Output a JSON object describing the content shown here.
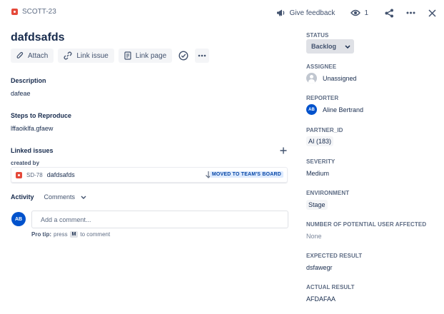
{
  "header": {
    "issue_key": "SCOTT-23",
    "feedback_label": "Give feedback",
    "watch_count": "1"
  },
  "issue": {
    "title": "dafdsafds"
  },
  "toolbar": {
    "attach_label": "Attach",
    "link_issue_label": "Link issue",
    "link_page_label": "Link page"
  },
  "description": {
    "heading": "Description",
    "text": "dafeae"
  },
  "steps": {
    "heading": "Steps to Reproduce",
    "text": "lffaoiklfa.gfaew"
  },
  "linked_issues": {
    "heading": "Linked issues",
    "created_by_label": "created by",
    "items": [
      {
        "key": "SD-78",
        "summary": "dafdsafds",
        "status": "MOVED TO TEAM'S BOARD"
      }
    ]
  },
  "activity": {
    "heading": "Activity",
    "filter_value": "Comments",
    "avatar_initials": "AB",
    "comment_placeholder": "Add a comment...",
    "protip_label": "Pro tip:",
    "protip_press": "press",
    "protip_key": "M",
    "protip_suffix": "to comment"
  },
  "sidebar": {
    "status_label": "STATUS",
    "status_value": "Backlog",
    "assignee_label": "ASSIGNEE",
    "assignee_value": "Unassigned",
    "reporter_label": "REPORTER",
    "reporter_initials": "AB",
    "reporter_name": "Aline Bertrand",
    "partner_id_label": "PARTNER_ID",
    "partner_id_value": "AI (183)",
    "severity_label": "SEVERITY",
    "severity_value": "Medium",
    "environment_label": "ENVIRONMENT",
    "environment_value": "Stage",
    "users_affected_label": "NUMBER OF POTENTIAL USER AFFECTED",
    "users_affected_value": "None",
    "expected_label": "EXPECTED RESULT",
    "expected_value": "dsfawegr",
    "actual_label": "ACTUAL RESULT",
    "actual_value": "AFDAFAA"
  },
  "colors": {
    "bug": "#e5493a",
    "accent": "#0052cc",
    "status_lozenge_bg": "#deebff",
    "status_lozenge_text": "#0747a6"
  },
  "icons": [
    "bug-icon",
    "megaphone-icon",
    "eye-icon",
    "share-icon",
    "more-icon",
    "close-icon",
    "paperclip-icon",
    "link-icon",
    "page-icon",
    "check-circle-icon",
    "plus-icon",
    "priority-low-icon",
    "chevron-down-icon"
  ]
}
